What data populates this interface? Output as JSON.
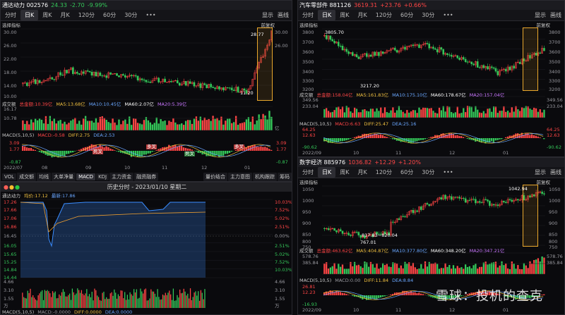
{
  "tl": {
    "name": "通达动力 002576",
    "price": "24.33",
    "chg": "-2.70",
    "pct": "-9.99%",
    "tabs": [
      "分时",
      "日K",
      "周K",
      "月K",
      "120分",
      "60分",
      "30分",
      "•••"
    ],
    "right": [
      "显示",
      "画线"
    ],
    "indicator": "选择指标",
    "fq": "前复权",
    "prices": [
      "30.00",
      "26.00",
      "22.00",
      "18.00",
      "14.00",
      "10.00"
    ],
    "rprices": [
      "30.00",
      "26.00"
    ],
    "hi": "28.77",
    "lo": "11.20",
    "vol_title": "成交额",
    "vol_total": "总金额:10.39亿",
    "ma5": "MA5:13.68亿",
    "ma10": "MA10:10.45亿",
    "ma60": "MA60:2.07亿",
    "ma20": "MA20:5.39亿",
    "vol_scale": [
      "16.17",
      "10.78",
      "亿"
    ],
    "macd": "MACD(5,10,5)",
    "macdv": "MACD:-0.58",
    "diff": "DIFF:2.75",
    "dea": "DEA:2.53",
    "macd_scale": [
      "3.09",
      "1.77",
      "-0.87"
    ],
    "dates": [
      "2022/07",
      "08",
      "09",
      "10",
      "11",
      "12",
      "01"
    ],
    "btns": [
      "VOL",
      "成交额",
      "均线",
      "大单净量",
      "MACD",
      "KDJ",
      "主力资金",
      "融资融券",
      "量价结合",
      "主力意图",
      "机构跟踪",
      "筹码"
    ],
    "cross": [
      "多叉",
      "死叉"
    ]
  },
  "tr": {
    "name": "汽车零部件 881126",
    "price": "3619.31",
    "chg": "+23.76",
    "pct": "+0.66%",
    "tabs": [
      "分时",
      "日K",
      "周K",
      "月K",
      "120分",
      "60分",
      "30分",
      "•••"
    ],
    "right": [
      "显示",
      "画线"
    ],
    "indicator": "选择指标",
    "fq": "前复权",
    "prices": [
      "3800",
      "3700",
      "3600",
      "3500",
      "3400",
      "3300",
      "3200"
    ],
    "hi": "3805.70",
    "lo": "3217.20",
    "vol_title": "成交额",
    "vol_total": "总金额:158.04亿",
    "ma5": "MA5:161.83亿",
    "ma10": "MA10:175.10亿",
    "ma60": "MA60:178.67亿",
    "ma20": "MA20:157.04亿",
    "vol_scale": [
      "349.56",
      "233.04"
    ],
    "macd": "MACD(5,10,5)",
    "macdv": "MACD:6.63",
    "diff": "DIFF:25.47",
    "dea": "DEA:25.16",
    "macd_scale": [
      "64.25",
      "12.63",
      "-90.62"
    ],
    "dates": [
      "2022/09",
      "10",
      "11",
      "12",
      "01"
    ]
  },
  "br": {
    "name": "数字经济 885976",
    "price": "1036.82",
    "chg": "+12.29",
    "pct": "+1.20%",
    "tabs": [
      "分时",
      "日K",
      "周K",
      "月K",
      "120分",
      "60分",
      "30分",
      "•••"
    ],
    "right": [
      "显示",
      "画线"
    ],
    "indicator": "选择指标",
    "fq": "前复权",
    "prices": [
      "1050",
      "1000",
      "950",
      "900",
      "850",
      "800",
      "750"
    ],
    "hi": "1042.94",
    "range": "817.83~820.04",
    "lo": "767.01",
    "vol_title": "成交额",
    "vol_total": "总金额:463.62亿",
    "ma5": "MA5:404.87亿",
    "ma10": "MA10:377.80亿",
    "ma60": "MA60:348.20亿",
    "ma20": "MA20:347.21亿",
    "vol_scale": [
      "578.76",
      "385.84"
    ],
    "macd": "MACD(5,10,5)",
    "macdv": "MACD:0.00",
    "diff": "DIFF:11.84",
    "dea": "DEA:8.84",
    "macd_scale": [
      "26.81",
      "12.23",
      "-16.93"
    ],
    "dates": [
      "2022/09",
      "10",
      "11",
      "12",
      "01"
    ]
  },
  "bl": {
    "title": "历史分时 - 2023/01/10 星期二",
    "name": "通达动力",
    "avg": "均价:17.12",
    "last": "最新:17.86",
    "lprices": [
      "17.26",
      "17.66",
      "17.06",
      "16.86",
      "16.45",
      "16.05",
      "15.65",
      "15.25",
      "14.84",
      "14.44"
    ],
    "rpct": [
      "10.03%",
      "7.52%",
      "5.02%",
      "2.51%",
      "0.00%",
      "2.51%",
      "5.02%",
      "7.52%",
      "10.03%"
    ],
    "vol_scale": [
      "4.66",
      "3.10",
      "1.55",
      "万"
    ],
    "macd": "MACD(5,10,5)",
    "macdv": "MACD:-0.0000",
    "diff": "DIFF:0.0000",
    "dea": "DEA:0.0000"
  },
  "watermark": "雪球：投机的查克"
}
